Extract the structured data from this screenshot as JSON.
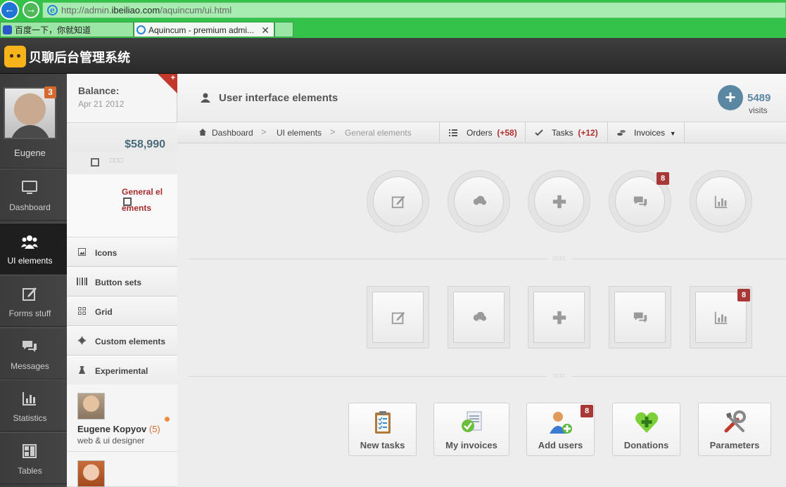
{
  "browser": {
    "url_prefix": "http://admin.",
    "url_domain": "ibeiliao.com",
    "url_path": "/aquincum/ui.html",
    "tabs": [
      {
        "label": "百度一下，你就知道"
      },
      {
        "label": "Aquincum - premium admi..."
      },
      {
        "label": ""
      }
    ]
  },
  "app": {
    "title": "贝聊后台管理系统"
  },
  "user": {
    "name": "Eugene",
    "notifications": "3"
  },
  "sidebar": {
    "items": [
      {
        "label": "Dashboard",
        "icon": "monitor-icon"
      },
      {
        "label": "UI elements",
        "icon": "users-icon",
        "active": true
      },
      {
        "label": "Forms stuff",
        "icon": "edit-icon"
      },
      {
        "label": "Messages",
        "icon": "chat-icon"
      },
      {
        "label": "Statistics",
        "icon": "bar-chart-icon"
      },
      {
        "label": "Tables",
        "icon": "table-icon"
      }
    ]
  },
  "balance": {
    "title": "Balance:",
    "date": "Apr 21 2012",
    "amount": "$58,990"
  },
  "sub_nav": {
    "current": "General elements",
    "items": [
      {
        "label": "Icons",
        "icon": "image-icon"
      },
      {
        "label": "Button sets",
        "icon": "barcode-icon"
      },
      {
        "label": "Grid",
        "icon": "grid-icon"
      },
      {
        "label": "Custom elements",
        "icon": "gear-icon"
      },
      {
        "label": "Experimental",
        "icon": "flask-icon"
      }
    ]
  },
  "contacts": [
    {
      "name": "Eugene Kopyov",
      "count": "(5)",
      "role": "web & ui designer"
    },
    {
      "name": "",
      "count": "",
      "role": ""
    }
  ],
  "header": {
    "title": "User interface elements",
    "visits_count": "5489",
    "visits_label": "visits",
    "visits_button": "+"
  },
  "breadcrumb": {
    "items": [
      "Dashboard",
      "UI elements",
      "General elements"
    ],
    "separator": ">"
  },
  "toolbar": {
    "orders_label": "Orders",
    "orders_count": "(+58)",
    "tasks_label": "Tasks",
    "tasks_count": "(+12)",
    "invoices_label": "Invoices"
  },
  "round_buttons": [
    {
      "icon": "edit-icon",
      "badge": ""
    },
    {
      "icon": "cloud-upload-icon",
      "badge": ""
    },
    {
      "icon": "plus-icon",
      "badge": ""
    },
    {
      "icon": "chat-icon",
      "badge": "8"
    },
    {
      "icon": "bar-chart-icon",
      "badge": ""
    }
  ],
  "square_buttons": [
    {
      "icon": "edit-icon",
      "badge": ""
    },
    {
      "icon": "cloud-upload-icon",
      "badge": ""
    },
    {
      "icon": "plus-icon",
      "badge": ""
    },
    {
      "icon": "chat-icon",
      "badge": ""
    },
    {
      "icon": "bar-chart-icon",
      "badge": "8"
    }
  ],
  "big_buttons": [
    {
      "label": "New tasks",
      "icon": "clipboard-icon",
      "badge": ""
    },
    {
      "label": "My invoices",
      "icon": "invoice-icon",
      "badge": ""
    },
    {
      "label": "Add users",
      "icon": "add-user-icon",
      "badge": "8"
    },
    {
      "label": "Donations",
      "icon": "heart-icon",
      "badge": ""
    },
    {
      "label": "Parameters",
      "icon": "tools-icon",
      "badge": ""
    }
  ],
  "colors": {
    "browser_green": "#34c24a",
    "header_dark": "#2e2e2e",
    "accent_blue": "#5a87a2",
    "badge_red": "#a83838",
    "badge_orange": "#d56a2e",
    "link_red": "#a52a2a"
  }
}
